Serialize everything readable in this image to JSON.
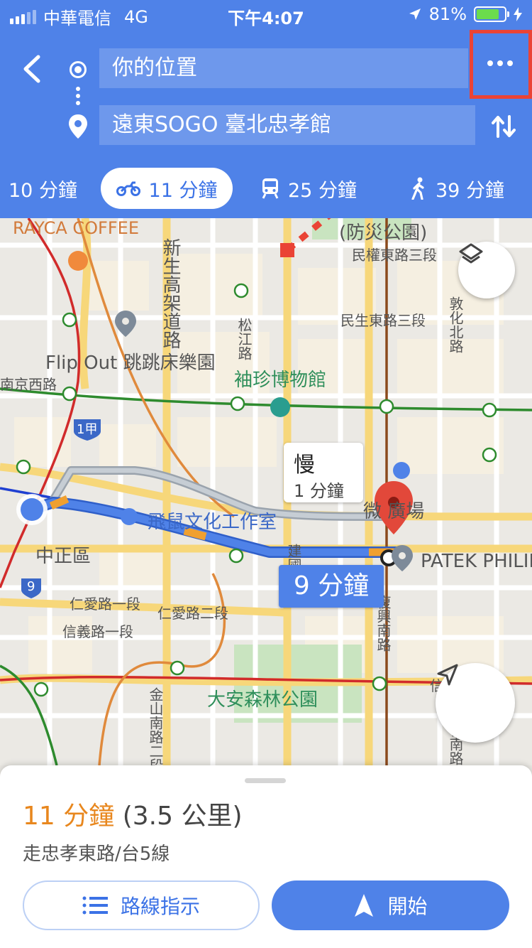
{
  "status_bar": {
    "carrier": "中華電信",
    "network": "4G",
    "time": "下午4:07",
    "battery": "81%",
    "battery_level": 0.81,
    "icons": [
      "signal-icon",
      "location-arrow-icon",
      "battery-icon",
      "charging-icon"
    ]
  },
  "header": {
    "origin": "你的位置",
    "destination": "遠東SOGO 臺北忠孝館",
    "icons": [
      "back-arrow-icon",
      "origin-dot-icon",
      "destination-pin-icon",
      "more-options-icon",
      "swap-icon"
    ],
    "modes": [
      {
        "icon": "car-icon",
        "label": "10 分鐘"
      },
      {
        "icon": "motorcycle-icon",
        "label": "11 分鐘",
        "selected": true
      },
      {
        "icon": "train-icon",
        "label": "25 分鐘"
      },
      {
        "icon": "walk-icon",
        "label": "39 分鐘"
      }
    ]
  },
  "map": {
    "labels": {
      "rayca": "RAYCA COFFEE",
      "park_north": "(防災公園)",
      "minquan": "民權東路三段",
      "minsheng": "民生東路三段",
      "xinsheng": "新生高架道路",
      "songjiang": "松江路",
      "dunhua": "敦化北路",
      "flipout": "Flip Out 跳跳床樂園",
      "museum": "袖珍博物館",
      "nanjing": "南京西路",
      "route1": "1甲",
      "flying_rat": "飛鼠文化工作室",
      "plaza": "微    廣場",
      "zhongzheng": "中正區",
      "patek": "PATEK PHILIPPE",
      "route9": "9",
      "renai1": "仁愛路一段",
      "renai2": "仁愛路二段",
      "xinyi1": "信義路一段",
      "jianguo": "建國南路",
      "fuxing": "復興南路",
      "daan": "大安森林公園",
      "xinyi_r": "信義路四段",
      "jinshan": "金山南路二段",
      "dunhua_s": "敦化南路二段"
    },
    "slow_bubble": {
      "title": "慢",
      "subtitle": "1 分鐘"
    },
    "route_badge": "9 分鐘",
    "icons": [
      "layers-icon",
      "navigate-arrow-icon",
      "destination-marker-icon",
      "current-location-icon"
    ],
    "annotation_color": "#ea4335"
  },
  "sheet": {
    "duration": "11 分鐘",
    "distance": "(3.5 公里)",
    "via": "走忠孝東路/台5線",
    "steps_label": "路線指示",
    "start_label": "開始"
  },
  "colors": {
    "primary": "#4f82e8",
    "orange": "#e8871e",
    "route_blue": "#4f82e8",
    "traffic_orange": "#f0a030",
    "marker_red": "#e2483a"
  }
}
